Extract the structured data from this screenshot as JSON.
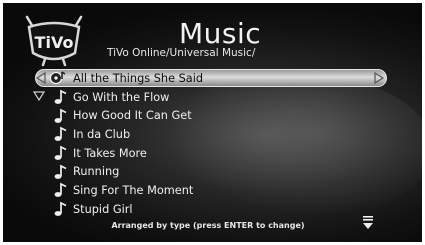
{
  "header": {
    "title": "Music",
    "breadcrumb": "TiVo Online/Universal Music/",
    "logo_text": "TiVo"
  },
  "songs": [
    {
      "label": "All the Things She Said",
      "selected": true
    },
    {
      "label": "Go With the Flow",
      "selected": false
    },
    {
      "label": "How Good It Can Get",
      "selected": false
    },
    {
      "label": "In da Club",
      "selected": false
    },
    {
      "label": "It Takes More",
      "selected": false
    },
    {
      "label": "Running",
      "selected": false
    },
    {
      "label": "Sing For The Moment",
      "selected": false
    },
    {
      "label": "Stupid Girl",
      "selected": false
    }
  ],
  "footer": {
    "hint": "Arranged by type (press ENTER to change)"
  },
  "icons": {
    "item": "music-note-icon",
    "selected_item": "music-disc-icon",
    "scroll": "scroll-down-icon"
  }
}
